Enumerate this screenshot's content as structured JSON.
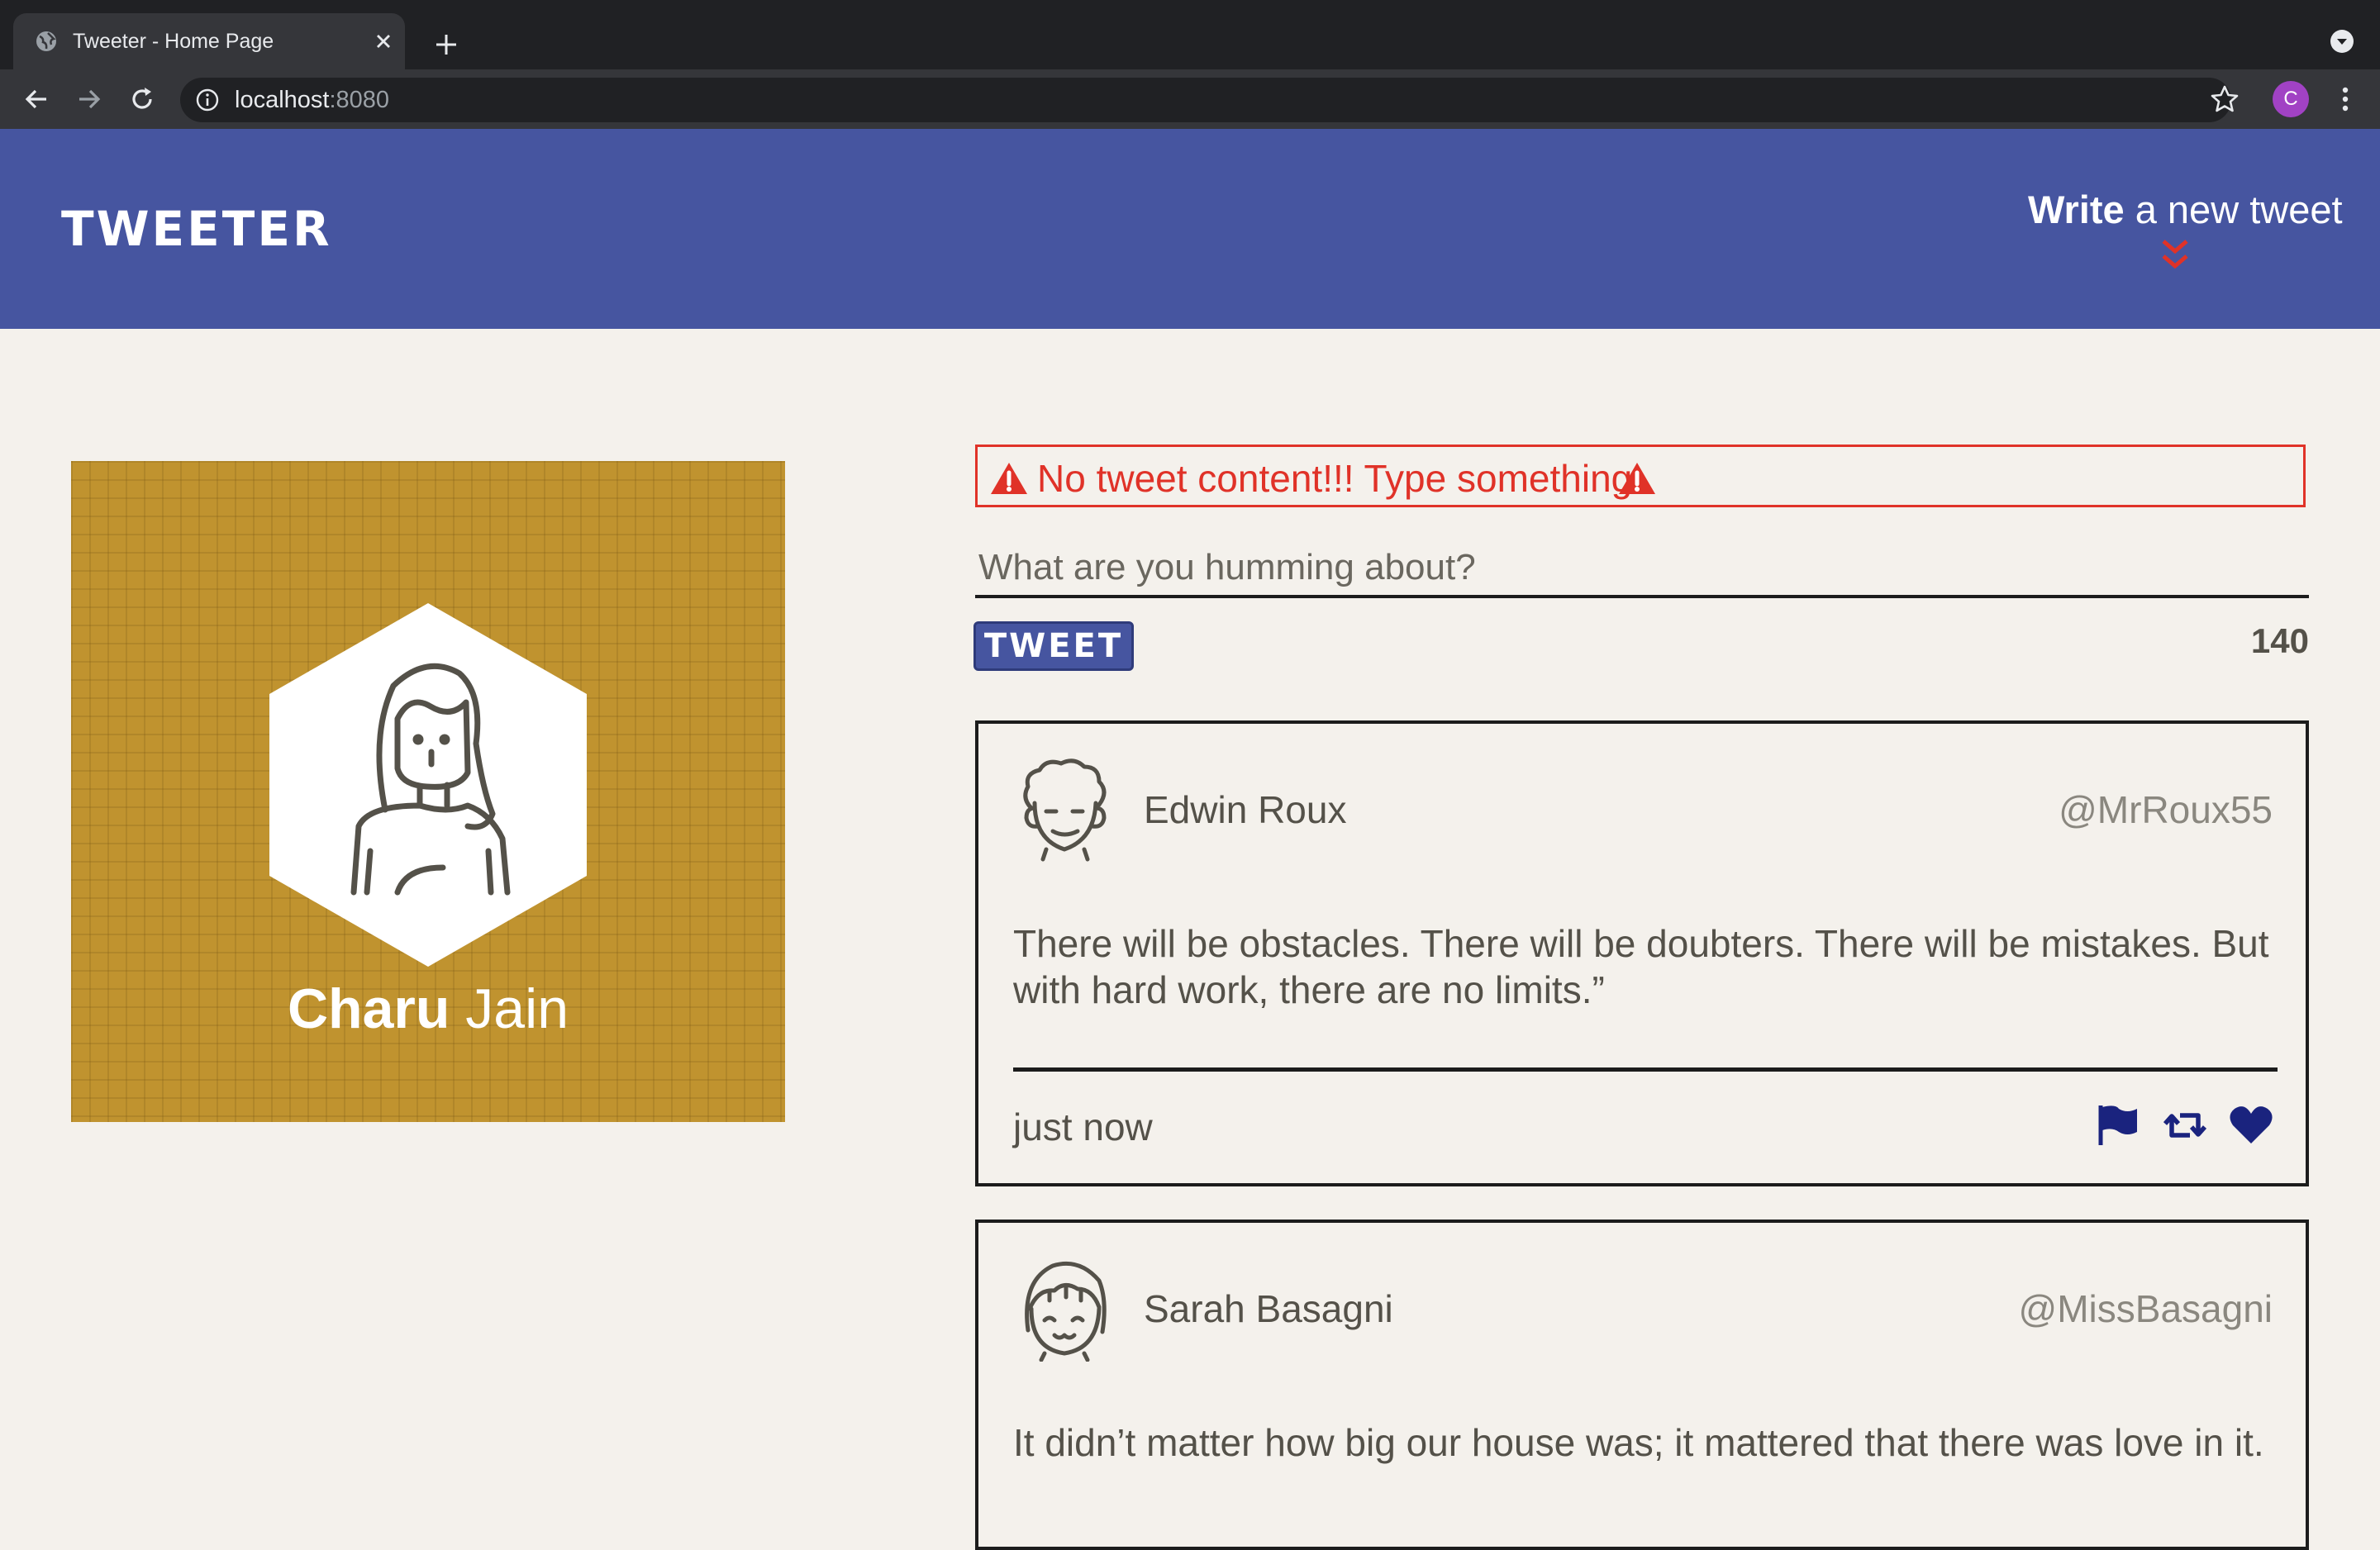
{
  "browser": {
    "tab_title": "Tweeter - Home Page",
    "url_host": "localhost",
    "url_port": ":8080",
    "profile_initial": "C"
  },
  "header": {
    "logo": "TWEETER",
    "write_bold": "Write",
    "write_rest": " a new tweet"
  },
  "profile": {
    "first_name": "Charu",
    "last_name": " Jain",
    "card_color": "#c0932f"
  },
  "compose": {
    "error_message": "No tweet content!!! Type something",
    "placeholder": "What are you humming about?",
    "button_label": "TWEET",
    "char_count": "140"
  },
  "tweets": [
    {
      "name": "Edwin Roux",
      "handle": "@MrRoux55",
      "text": "There will be obstacles. There will be doubters. There will be mistakes. But with hard work, there are no limits.”",
      "time": "just now"
    },
    {
      "name": "Sarah Basagni",
      "handle": "@MissBasagni",
      "text": "It didn’t matter how big our house was; it mattered that there was love in it."
    }
  ],
  "colors": {
    "header_bg": "#4655a0",
    "error": "#e03228",
    "action_icons": "#1a237e",
    "page_bg": "#f4f1ec"
  }
}
